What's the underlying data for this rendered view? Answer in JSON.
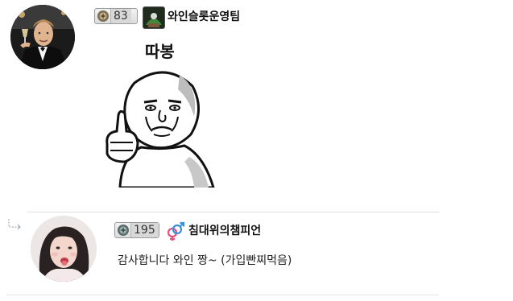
{
  "comments": [
    {
      "level": "83",
      "nickname": "와인슬롯운영팀",
      "emoticon_text": "따봉",
      "avatar": "man-in-suit-raising-glass-avatar",
      "game_icon": "green-game-character-icon"
    }
  ],
  "replies": [
    {
      "level": "195",
      "gender_icon": "male-female-gender-icon",
      "nickname": "침대위의챔피언",
      "text": "감사합니다 와인 짱~ (가입빤찌먹음)",
      "avatar": "woman-portrait-avatar",
      "reply_marker": "reply-arrow-icon"
    }
  ],
  "colors": {
    "divider": "#dedede",
    "male_symbol": "#3a8fd8",
    "female_symbol": "#e8507e"
  }
}
